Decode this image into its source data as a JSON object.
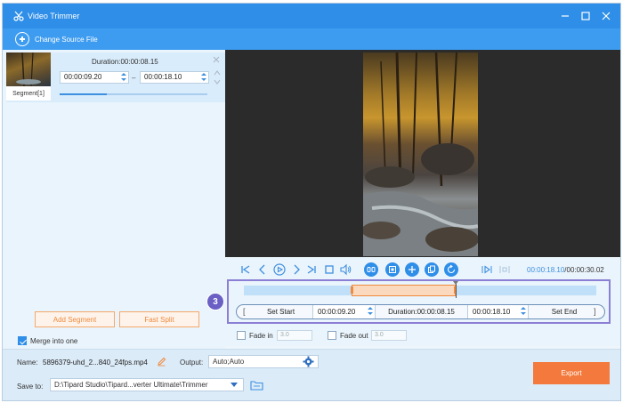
{
  "window": {
    "title": "Video Trimmer"
  },
  "toolbar": {
    "change_source": "Change Source File"
  },
  "segment": {
    "tag": "Segment[1]",
    "duration": "Duration:00:00:08.15",
    "start": "00:00:09.20",
    "dash": "–",
    "end": "00:00:18.10",
    "progress": 0.32
  },
  "left_actions": {
    "add_segment": "Add Segment",
    "fast_split": "Fast Split",
    "merge_label": "Merge into one",
    "merge_checked": true
  },
  "playback": {
    "current": "00:00:18.10",
    "total": "/00:00:30.02"
  },
  "step_badge": "3",
  "trim": {
    "clip_start_fraction": 0.306,
    "clip_end_fraction": 0.6,
    "playhead_fraction": 0.6,
    "bracket_left": "[",
    "set_start": "Set Start",
    "start_time": "00:00:09.20",
    "duration": "Duration:00:00:08.15",
    "end_time": "00:00:18.10",
    "set_end": "Set End",
    "bracket_right": "]"
  },
  "fade": {
    "fade_in_label": "Fade in",
    "fade_in_value": "3.0",
    "fade_out_label": "Fade out",
    "fade_out_value": "3.0"
  },
  "bottom": {
    "name_label": "Name:",
    "name_value": "5896379-uhd_2...840_24fps.mp4",
    "output_label": "Output:",
    "output_value": "Auto;Auto",
    "save_label": "Save to:",
    "save_value": "D:\\Tipard Studio\\Tipard...verter Ultimate\\Trimmer",
    "export": "Export"
  },
  "colors": {
    "titlebar": "#2e8ee8",
    "accent": "#3d8fe0",
    "orange": "#f37a3c",
    "badge": "#6a5fc4"
  }
}
